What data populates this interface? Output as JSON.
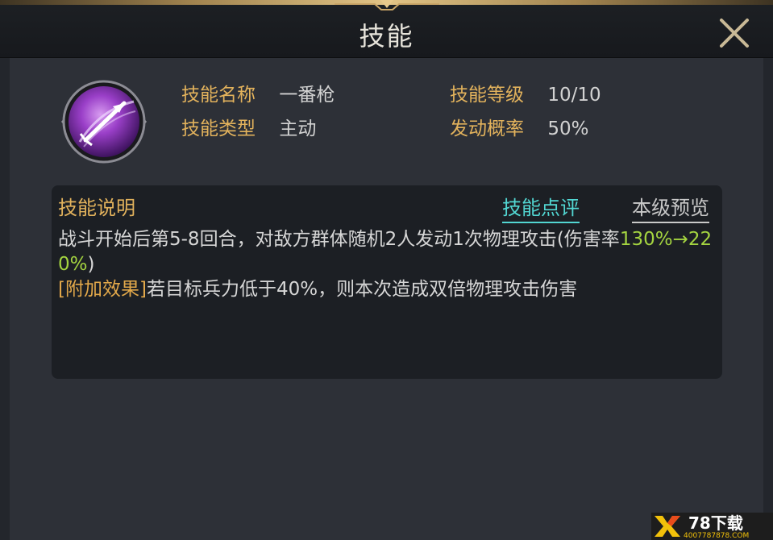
{
  "header": {
    "title": "技能",
    "close_icon": "close-x-icon"
  },
  "skill": {
    "icon": "purple-spear-orb-icon",
    "name_label": "技能名称",
    "name_value": "一番枪",
    "level_label": "技能等级",
    "level_value": "10/10",
    "type_label": "技能类型",
    "type_value": "主动",
    "chance_label": "发动概率",
    "chance_value": "50%"
  },
  "description": {
    "title": "技能说明",
    "tab_review": "技能点评",
    "tab_preview": "本级预览",
    "line1_text": "战斗开始后第5-8回合，对敌方群体随机2人发动1次物理攻击(伤害率",
    "line1_highlight": "130%→220%",
    "line1_end": ")",
    "extra_tag": "[附加效果]",
    "extra_text": "若目标兵力低于40%，则本次造成双倍物理攻击伤害"
  },
  "watermark": {
    "brand": "78下载",
    "url": "4007787878.COM"
  },
  "colors": {
    "label_gold": "#e2b25c",
    "value_gray": "#d2d2d2",
    "highlight_green": "#a4d440",
    "review_cyan": "#52d6d2",
    "panel_bg": "#2d3037",
    "desc_bg": "#1c1f24"
  }
}
